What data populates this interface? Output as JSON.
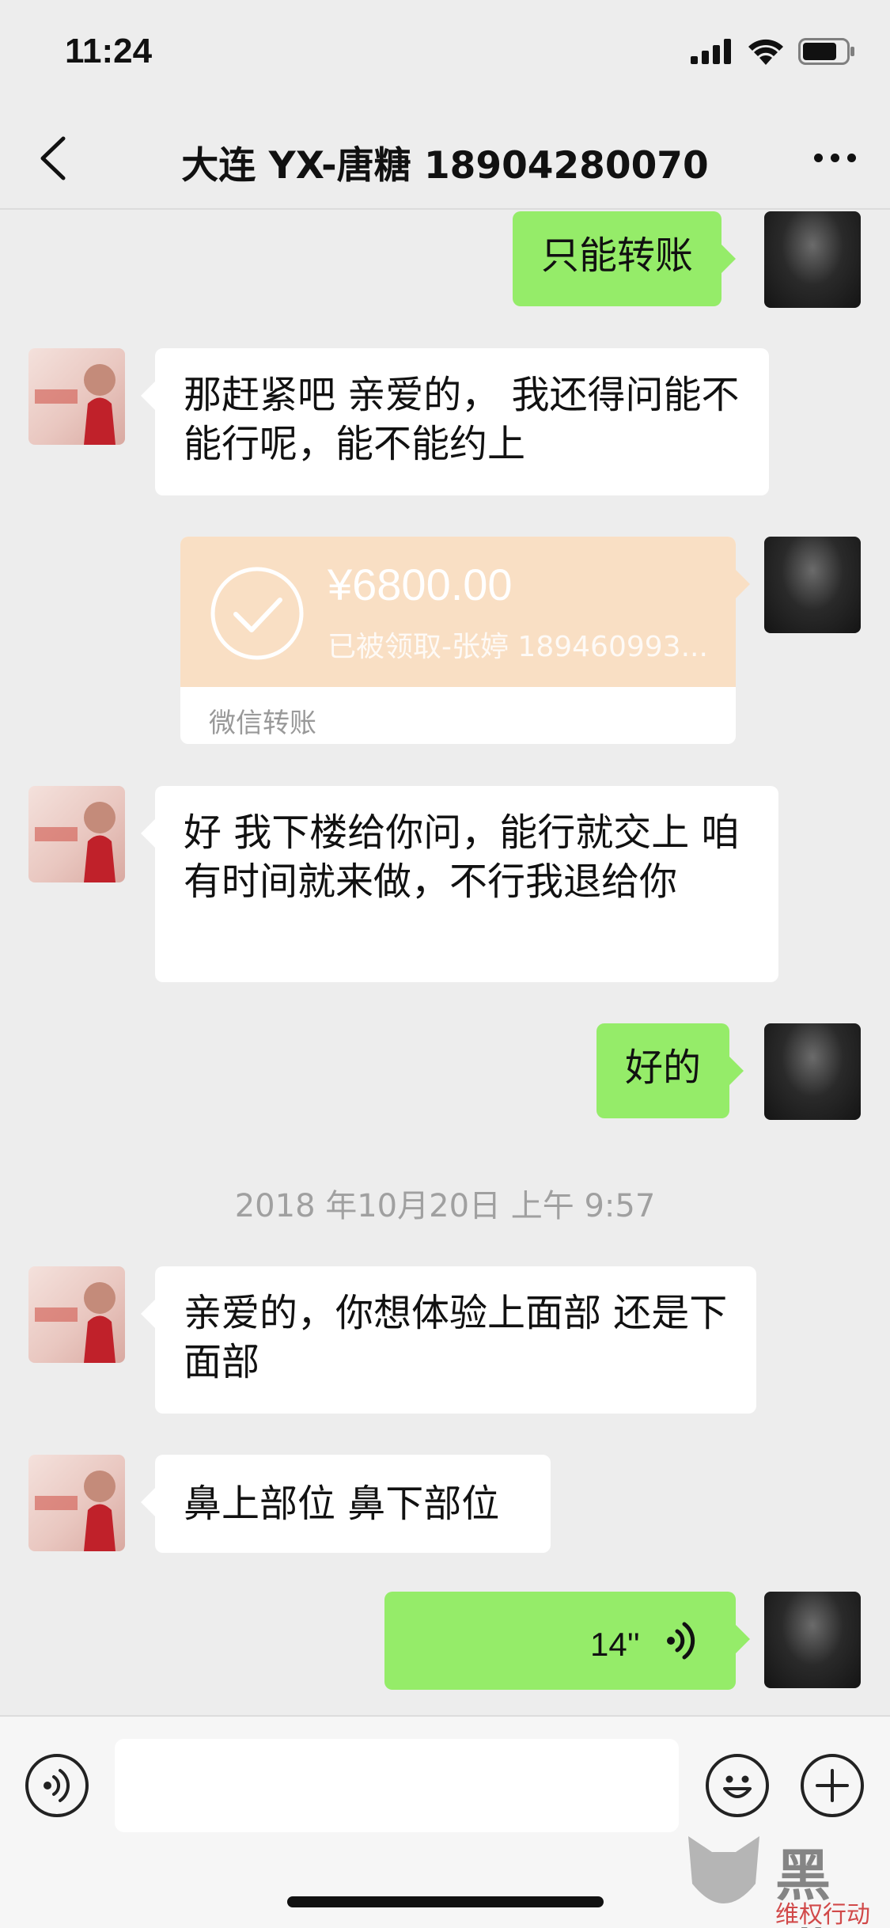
{
  "status_bar": {
    "time": "11:24"
  },
  "nav": {
    "title": "大连 YX-唐糖 18904280070"
  },
  "messages": {
    "m1": {
      "text": "只能转账"
    },
    "m2": {
      "text": "那赶紧吧 亲爱的， 我还得问能不能行呢，能不能约上"
    },
    "transfer": {
      "amount": "¥6800.00",
      "note": "已被领取-张婷 189460993...",
      "label": "微信转账"
    },
    "m3": {
      "text": " 好  我下楼给你问，能行就交上  咱有时间就来做，不行我退给你"
    },
    "m4": {
      "text": "好的"
    },
    "timestamp": "2018 年10月20日 上午 9:57",
    "m5": {
      "text": "亲爱的，你想体验上面部 还是下面部"
    },
    "m6": {
      "text": "鼻上部位 鼻下部位"
    },
    "voice": {
      "duration": "14''"
    }
  },
  "input_bar": {
    "voice_icon": "voice-mode-icon",
    "emoji_icon": "emoji-icon",
    "plus_icon": "plus-icon"
  },
  "watermark": {
    "text": "黑猫",
    "sub": "维权行动"
  },
  "colors": {
    "background": "#ededed",
    "self_bubble": "#95ec69",
    "other_bubble": "#ffffff",
    "transfer": "#f9dfc4"
  }
}
